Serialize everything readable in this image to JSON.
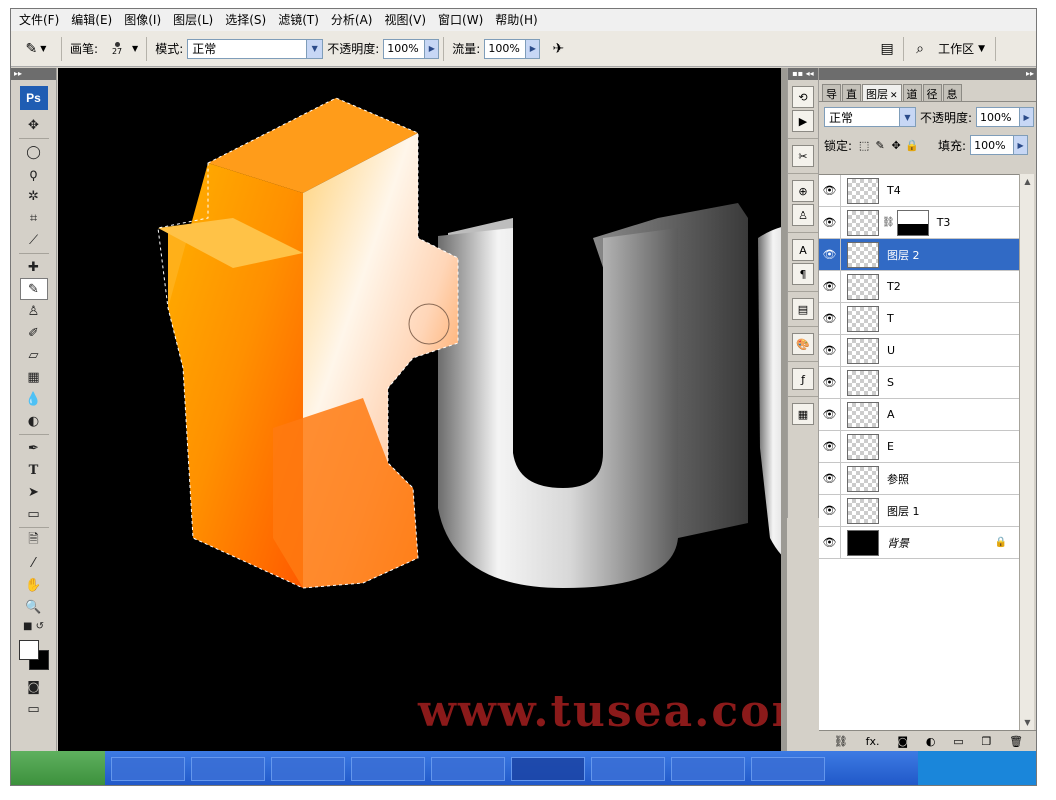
{
  "menu": [
    "文件(F)",
    "编辑(E)",
    "图像(I)",
    "图层(L)",
    "选择(S)",
    "滤镜(T)",
    "分析(A)",
    "视图(V)",
    "窗口(W)",
    "帮助(H)"
  ],
  "options": {
    "brush_label": "画笔:",
    "brush_size": "27",
    "mode_label": "模式:",
    "mode_value": "正常",
    "opacity_label": "不透明度:",
    "opacity_value": "100%",
    "flow_label": "流量:",
    "flow_value": "100%",
    "workspace_label": "工作区"
  },
  "toolbox": {
    "logo": "Ps",
    "tools": [
      "move-tool",
      "marquee-tool",
      "lasso-tool",
      "magic-wand-tool",
      "crop-tool",
      "slice-tool",
      "healing-brush-tool",
      "brush-tool",
      "clone-stamp-tool",
      "history-brush-tool",
      "eraser-tool",
      "gradient-tool",
      "blur-tool",
      "dodge-tool",
      "pen-tool",
      "type-tool",
      "path-selection-tool",
      "shape-tool",
      "notes-tool",
      "eyedropper-tool",
      "hand-tool",
      "zoom-tool"
    ],
    "active_tool": "brush-tool"
  },
  "canvas": {
    "watermark": "www.tusea.com",
    "watermark_color": "#8b1a1a"
  },
  "layers_panel": {
    "tabs": [
      "导",
      "直",
      "图层",
      "道",
      "径",
      "息"
    ],
    "active_tab": "图层",
    "blend_mode": "正常",
    "opacity_label": "不透明度:",
    "opacity_value": "100%",
    "lock_label": "锁定:",
    "fill_label": "填充:",
    "fill_value": "100%",
    "layers": [
      {
        "name": "T4",
        "selected": false,
        "has_mask": false
      },
      {
        "name": "T3",
        "selected": false,
        "has_mask": true
      },
      {
        "name": "图层 2",
        "selected": true,
        "has_mask": false
      },
      {
        "name": "T2",
        "selected": false,
        "has_mask": false
      },
      {
        "name": "T",
        "selected": false,
        "has_mask": false
      },
      {
        "name": "U",
        "selected": false,
        "has_mask": false
      },
      {
        "name": "S",
        "selected": false,
        "has_mask": false
      },
      {
        "name": "A",
        "selected": false,
        "has_mask": false
      },
      {
        "name": "E",
        "selected": false,
        "has_mask": false
      },
      {
        "name": "参照",
        "selected": false,
        "has_mask": false
      },
      {
        "name": "图层 1",
        "selected": false,
        "has_mask": false
      },
      {
        "name": "背景",
        "selected": false,
        "has_mask": false,
        "locked": true
      }
    ],
    "footer_fx": "fx."
  },
  "colors": {
    "selection_highlight": "#316ac5",
    "orange_letter": "#ff8a00",
    "taskbar": "#245edb"
  }
}
